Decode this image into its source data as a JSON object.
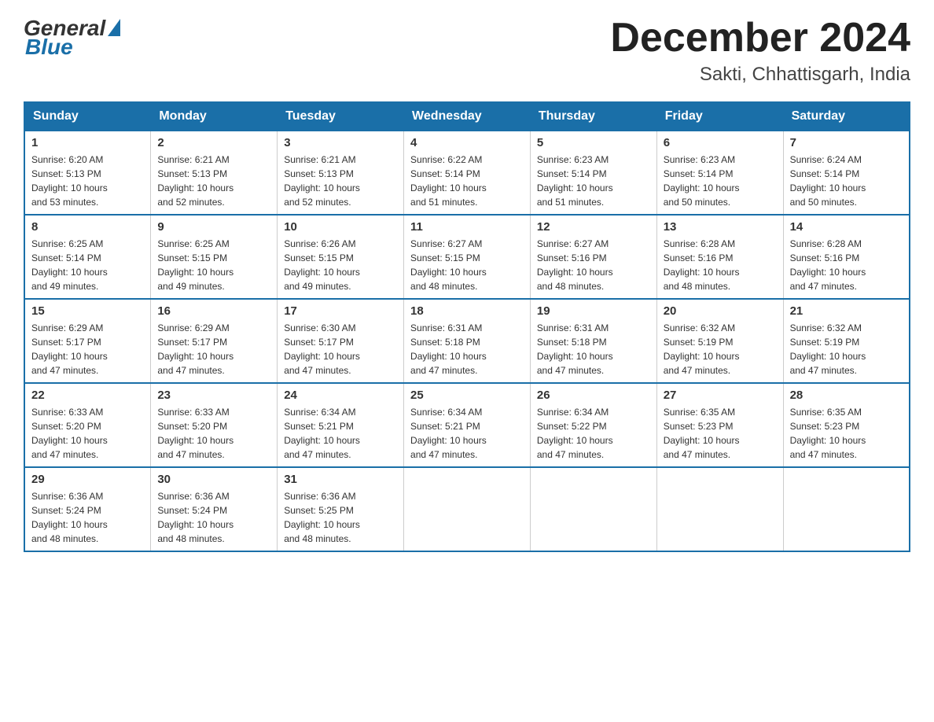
{
  "logo": {
    "general": "General",
    "blue": "Blue"
  },
  "header": {
    "month": "December 2024",
    "location": "Sakti, Chhattisgarh, India"
  },
  "weekdays": [
    "Sunday",
    "Monday",
    "Tuesday",
    "Wednesday",
    "Thursday",
    "Friday",
    "Saturday"
  ],
  "weeks": [
    [
      {
        "day": "1",
        "sunrise": "6:20 AM",
        "sunset": "5:13 PM",
        "daylight": "10 hours and 53 minutes."
      },
      {
        "day": "2",
        "sunrise": "6:21 AM",
        "sunset": "5:13 PM",
        "daylight": "10 hours and 52 minutes."
      },
      {
        "day": "3",
        "sunrise": "6:21 AM",
        "sunset": "5:13 PM",
        "daylight": "10 hours and 52 minutes."
      },
      {
        "day": "4",
        "sunrise": "6:22 AM",
        "sunset": "5:14 PM",
        "daylight": "10 hours and 51 minutes."
      },
      {
        "day": "5",
        "sunrise": "6:23 AM",
        "sunset": "5:14 PM",
        "daylight": "10 hours and 51 minutes."
      },
      {
        "day": "6",
        "sunrise": "6:23 AM",
        "sunset": "5:14 PM",
        "daylight": "10 hours and 50 minutes."
      },
      {
        "day": "7",
        "sunrise": "6:24 AM",
        "sunset": "5:14 PM",
        "daylight": "10 hours and 50 minutes."
      }
    ],
    [
      {
        "day": "8",
        "sunrise": "6:25 AM",
        "sunset": "5:14 PM",
        "daylight": "10 hours and 49 minutes."
      },
      {
        "day": "9",
        "sunrise": "6:25 AM",
        "sunset": "5:15 PM",
        "daylight": "10 hours and 49 minutes."
      },
      {
        "day": "10",
        "sunrise": "6:26 AM",
        "sunset": "5:15 PM",
        "daylight": "10 hours and 49 minutes."
      },
      {
        "day": "11",
        "sunrise": "6:27 AM",
        "sunset": "5:15 PM",
        "daylight": "10 hours and 48 minutes."
      },
      {
        "day": "12",
        "sunrise": "6:27 AM",
        "sunset": "5:16 PM",
        "daylight": "10 hours and 48 minutes."
      },
      {
        "day": "13",
        "sunrise": "6:28 AM",
        "sunset": "5:16 PM",
        "daylight": "10 hours and 48 minutes."
      },
      {
        "day": "14",
        "sunrise": "6:28 AM",
        "sunset": "5:16 PM",
        "daylight": "10 hours and 47 minutes."
      }
    ],
    [
      {
        "day": "15",
        "sunrise": "6:29 AM",
        "sunset": "5:17 PM",
        "daylight": "10 hours and 47 minutes."
      },
      {
        "day": "16",
        "sunrise": "6:29 AM",
        "sunset": "5:17 PM",
        "daylight": "10 hours and 47 minutes."
      },
      {
        "day": "17",
        "sunrise": "6:30 AM",
        "sunset": "5:17 PM",
        "daylight": "10 hours and 47 minutes."
      },
      {
        "day": "18",
        "sunrise": "6:31 AM",
        "sunset": "5:18 PM",
        "daylight": "10 hours and 47 minutes."
      },
      {
        "day": "19",
        "sunrise": "6:31 AM",
        "sunset": "5:18 PM",
        "daylight": "10 hours and 47 minutes."
      },
      {
        "day": "20",
        "sunrise": "6:32 AM",
        "sunset": "5:19 PM",
        "daylight": "10 hours and 47 minutes."
      },
      {
        "day": "21",
        "sunrise": "6:32 AM",
        "sunset": "5:19 PM",
        "daylight": "10 hours and 47 minutes."
      }
    ],
    [
      {
        "day": "22",
        "sunrise": "6:33 AM",
        "sunset": "5:20 PM",
        "daylight": "10 hours and 47 minutes."
      },
      {
        "day": "23",
        "sunrise": "6:33 AM",
        "sunset": "5:20 PM",
        "daylight": "10 hours and 47 minutes."
      },
      {
        "day": "24",
        "sunrise": "6:34 AM",
        "sunset": "5:21 PM",
        "daylight": "10 hours and 47 minutes."
      },
      {
        "day": "25",
        "sunrise": "6:34 AM",
        "sunset": "5:21 PM",
        "daylight": "10 hours and 47 minutes."
      },
      {
        "day": "26",
        "sunrise": "6:34 AM",
        "sunset": "5:22 PM",
        "daylight": "10 hours and 47 minutes."
      },
      {
        "day": "27",
        "sunrise": "6:35 AM",
        "sunset": "5:23 PM",
        "daylight": "10 hours and 47 minutes."
      },
      {
        "day": "28",
        "sunrise": "6:35 AM",
        "sunset": "5:23 PM",
        "daylight": "10 hours and 47 minutes."
      }
    ],
    [
      {
        "day": "29",
        "sunrise": "6:36 AM",
        "sunset": "5:24 PM",
        "daylight": "10 hours and 48 minutes."
      },
      {
        "day": "30",
        "sunrise": "6:36 AM",
        "sunset": "5:24 PM",
        "daylight": "10 hours and 48 minutes."
      },
      {
        "day": "31",
        "sunrise": "6:36 AM",
        "sunset": "5:25 PM",
        "daylight": "10 hours and 48 minutes."
      },
      null,
      null,
      null,
      null
    ]
  ],
  "labels": {
    "sunrise": "Sunrise:",
    "sunset": "Sunset:",
    "daylight": "Daylight:"
  }
}
